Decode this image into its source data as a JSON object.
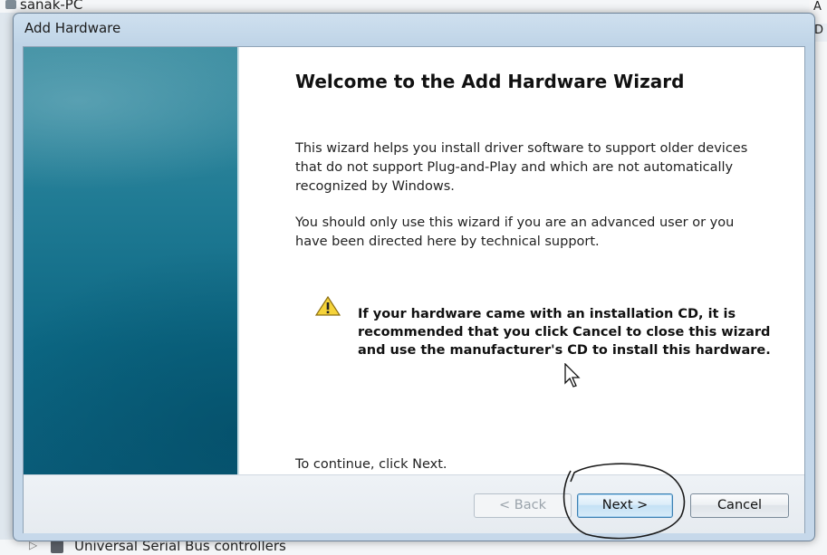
{
  "background": {
    "top_item": "sanak-PC",
    "right_a": "A",
    "right_d": "D",
    "bottom_item": "Universal Serial Bus controllers"
  },
  "dialog": {
    "title": "Add Hardware",
    "heading": "Welcome to the Add Hardware Wizard",
    "paragraph1": "This wizard helps you install driver software to support older devices that do not support Plug-and-Play and which are not automatically recognized by Windows.",
    "paragraph2": "You should only use this wizard if you are an advanced user or you have been directed here by technical support.",
    "warning": "If your hardware came with an installation CD, it is recommended that you click Cancel to close this wizard and use the manufacturer's CD to install this hardware.",
    "continue_text": "To continue, click Next.",
    "icons": {
      "warning": "warning-icon"
    },
    "colors": {
      "banner": "#0f6a86",
      "next_border": "#3c7fb1"
    }
  },
  "buttons": {
    "back": "< Back",
    "next": "Next >",
    "cancel": "Cancel"
  }
}
